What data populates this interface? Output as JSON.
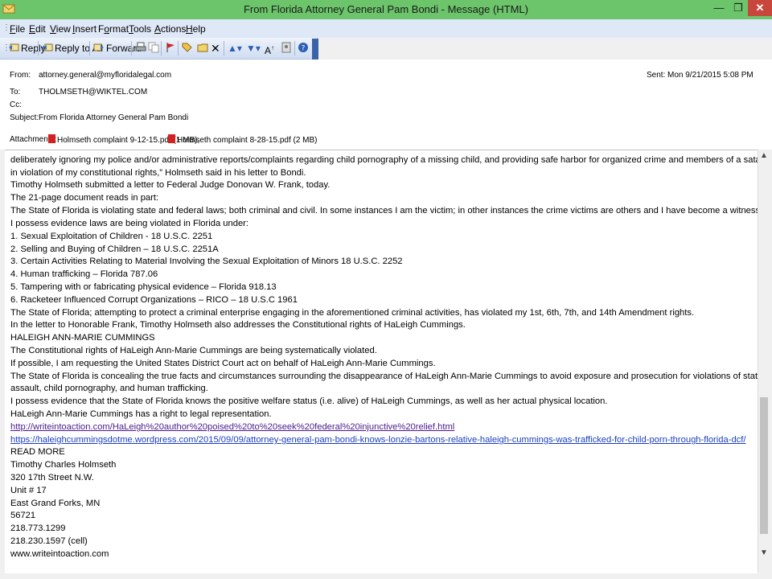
{
  "window": {
    "title": "From Florida Attorney General Pam Bondi - Message (HTML)"
  },
  "menu": [
    {
      "label": "File",
      "key": "F",
      "rest": "ile"
    },
    {
      "label": "Edit",
      "key": "E",
      "rest": "dit"
    },
    {
      "label": "View",
      "key": "V",
      "rest": "iew"
    },
    {
      "label": "Insert",
      "key": "I",
      "rest": "nsert"
    },
    {
      "label": "Format",
      "key": "",
      "pre": "F",
      "key2": "o",
      "rest": "rmat"
    },
    {
      "label": "Tools",
      "key": "T",
      "rest": "ools"
    },
    {
      "label": "Actions",
      "key": "A",
      "rest": "ctions"
    },
    {
      "label": "Help",
      "key": "H",
      "rest": "elp"
    }
  ],
  "toolbar": {
    "reply": "Reply",
    "reply_all": "Reply to All",
    "forward": "Forward"
  },
  "header": {
    "from_label": "From:",
    "from": "attorney.general@myfloridalegal.com",
    "to_label": "To:",
    "to": "THOLMSETH@WIKTEL.COM",
    "cc_label": "Cc:",
    "subject_label": "Subject:",
    "subject": "From Florida Attorney General Pam Bondi",
    "sent_label": "Sent:",
    "sent": "Mon 9/21/2015 5:08 PM",
    "attachments_label": "Attachments:",
    "attachments": [
      "Holmseth complaint 9-12-15.pdf (1 MB);",
      "Holmseth complaint 8-28-15.pdf (2 MB)"
    ]
  },
  "body_lines": [
    "deliberately ignoring my police and/or administrative reports/complaints regarding child pornography of a missing child, and providing safe harbor for organized crime and members of a satanic cult to stage operations against me",
    "in violation of my constitutional rights,” Holmseth said in his letter to Bondi.",
    "Timothy Holmseth submitted a letter to Federal Judge Donovan W. Frank, today.",
    "The 21-page document reads in part:",
    "The State of Florida is violating state and federal laws; both criminal and civil. In some instances I am the victim; in other instances the crime victims are others and I have become a witness through my journalism.",
    "I possess evidence laws are being violated in Florida under:",
    "1. Sexual Exploitation of Children - 18 U.S.C. 2251",
    "2. Selling and Buying of Children – 18 U.S.C. 2251A",
    "3. Certain Activities Relating to Material Involving the Sexual Exploitation of Minors 18 U.S.C. 2252",
    "4. Human trafficking – Florida 787.06",
    "5. Tampering with or fabricating physical evidence – Florida 918.13",
    "6. Racketeer Influenced Corrupt Organizations – RICO – 18 U.S.C 1961",
    "The State of Florida; attempting to protect a criminal enterprise engaging in the aforementioned criminal activities, has violated my 1st, 6th, 7th, and 14th Amendment rights.",
    "In the letter to Honorable Frank, Timothy Holmseth also addresses the Constitutional rights of HaLeigh Cummings.",
    "HALEIGH ANN-MARIE CUMMINGS",
    "The Constitutional rights of HaLeigh Ann-Marie Cummings are being systematically violated.",
    "If possible, I am requesting the United States District Court act on behalf of HaLeigh Ann-Marie Cummings.",
    "The State of Florida is concealing the true facts and circumstances surrounding the disappearance of HaLeigh Ann-Marie Cummings to avoid exposure and prosecution for violations of state and federal laws that include sexual",
    "assault, child pornography, and human trafficking.",
    "I possess evidence that the State of Florida knows the positive welfare status (i.e. alive) of HaLeigh Cummings, as well as her actual physical location.",
    "HaLeigh Ann-Marie Cummings has a right to legal representation."
  ],
  "links": [
    "http://writeintoaction.com/HaLeigh%20author%20poised%20to%20seek%20federal%20injunctive%20relief.html",
    "https://haleighcummingsdotme.wordpress.com/2015/09/09/attorney-general-pam-bondi-knows-lonzie-bartons-relative-haleigh-cummings-was-trafficked-for-child-porn-through-florida-dcf/"
  ],
  "signature_lines": [
    "READ MORE",
    "Timothy Charles Holmseth",
    "320 17th Street N.W.",
    "Unit # 17",
    "East Grand Forks, MN",
    "56721",
    "218.773.1299",
    "218.230.1597 (cell)",
    "www.writeintoaction.com"
  ]
}
